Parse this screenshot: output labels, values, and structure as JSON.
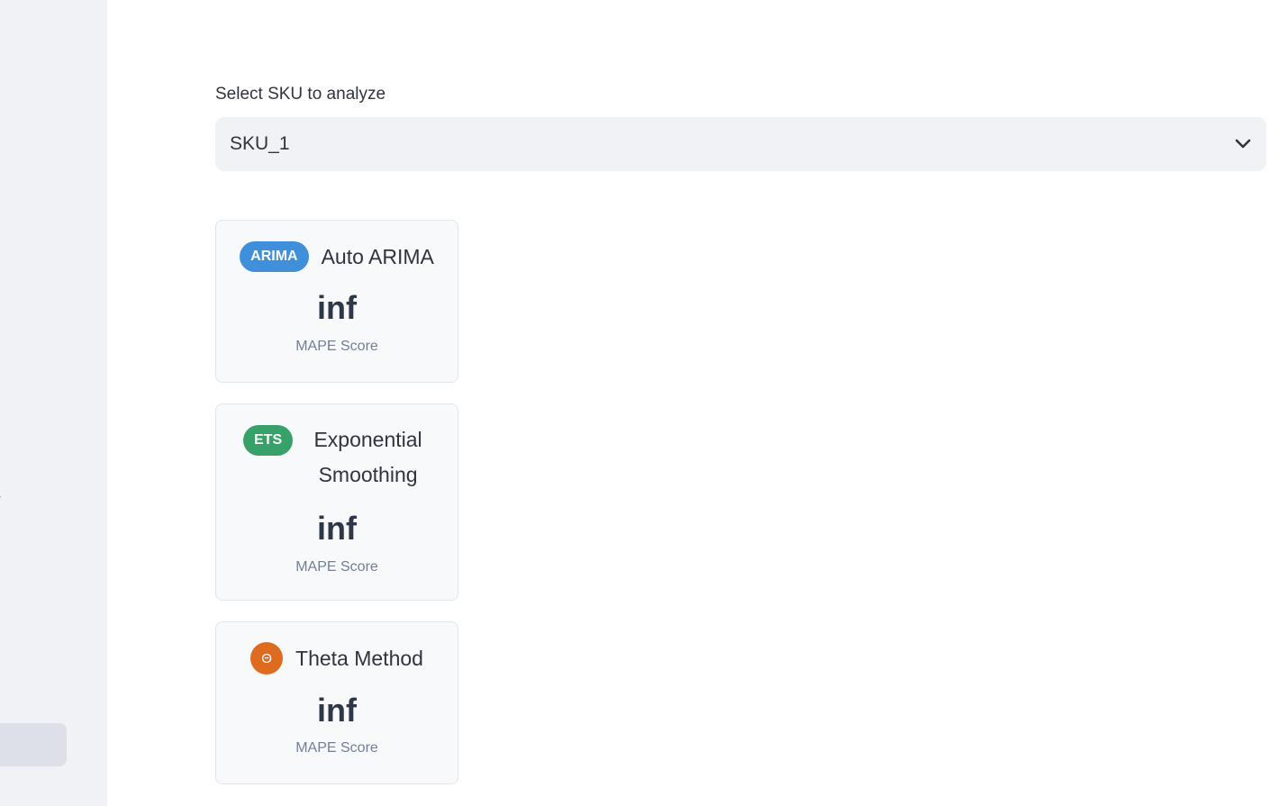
{
  "sidebar": {
    "partial_text": "w"
  },
  "select": {
    "label": "Select SKU to analyze",
    "value": "SKU_1",
    "icon": "chevron-down-icon"
  },
  "models": [
    {
      "badge": "ARIMA",
      "name": "Auto ARIMA",
      "score": "inf",
      "score_label": "MAPE Score",
      "color": "#3f8fdb"
    },
    {
      "badge": "ETS",
      "name": "Exponential Smoothing",
      "score": "inf",
      "score_label": "MAPE Score",
      "color": "#38a169"
    },
    {
      "badge": "Θ",
      "name": "Theta Method",
      "score": "inf",
      "score_label": "MAPE Score",
      "color": "#dd6b20"
    }
  ]
}
